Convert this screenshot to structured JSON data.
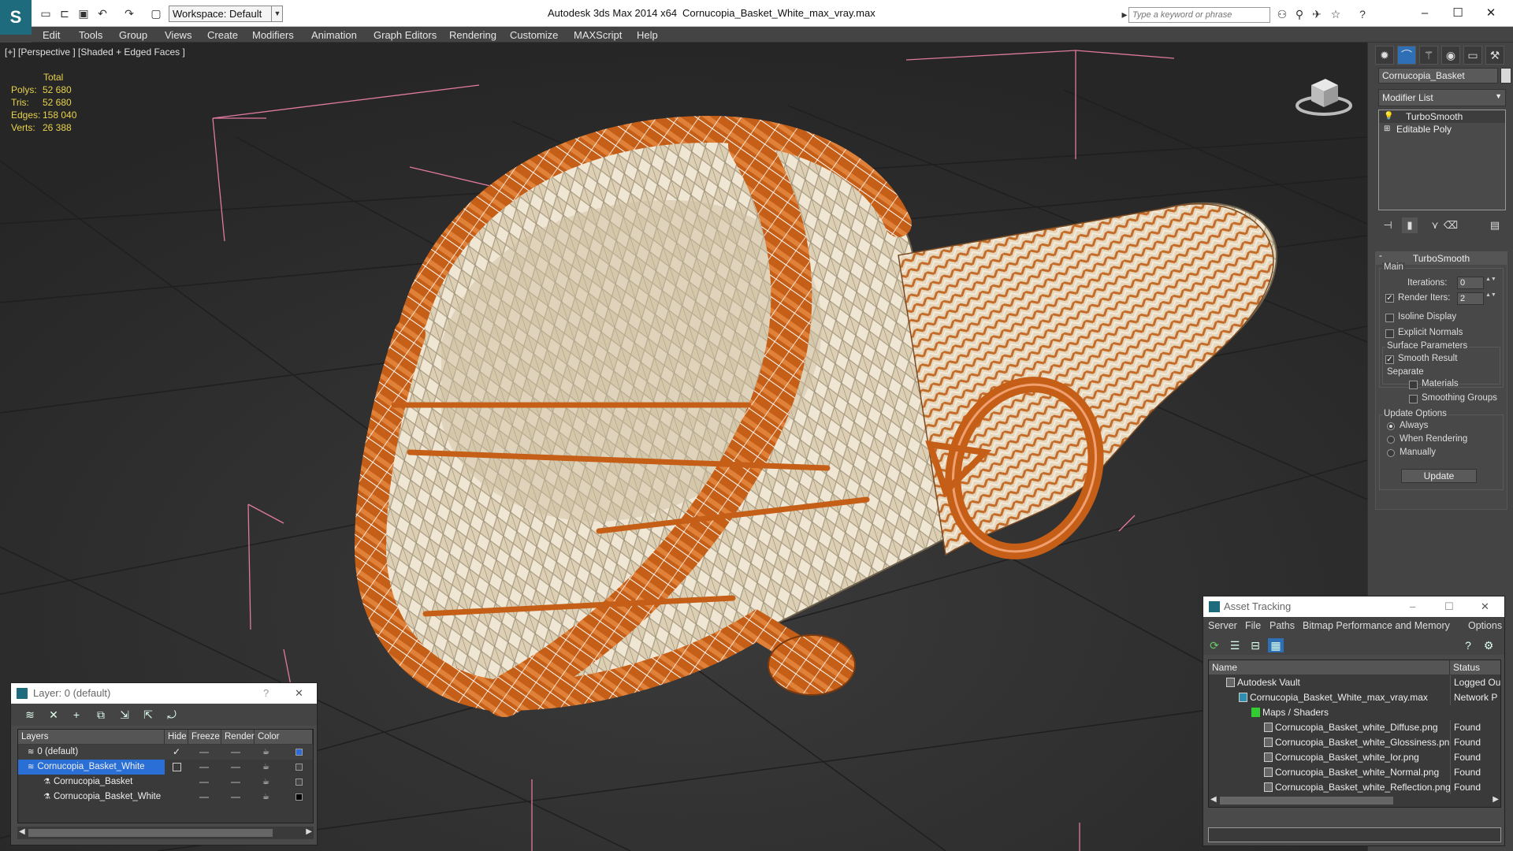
{
  "app": {
    "name": "Autodesk 3ds Max  2014 x64",
    "file": "Cornucopia_Basket_White_max_vray.max",
    "workspace": "Workspace: Default",
    "search_placeholder": "Type a keyword or phrase"
  },
  "menu": [
    "Edit",
    "Tools",
    "Group",
    "Views",
    "Create",
    "Modifiers",
    "Animation",
    "Graph Editors",
    "Rendering",
    "Customize",
    "MAXScript",
    "Help"
  ],
  "viewport": {
    "label": "[+] [Perspective ] [Shaded + Edged Faces ]",
    "stats": {
      "header": "Total",
      "rows": [
        {
          "key": "Polys:",
          "value": "52 680"
        },
        {
          "key": "Tris:",
          "value": "52 680"
        },
        {
          "key": "Edges:",
          "value": "158 040"
        },
        {
          "key": "Verts:",
          "value": "26 388"
        }
      ]
    }
  },
  "command_panel": {
    "object_name": "Cornucopia_Basket",
    "modifier_list": "Modifier List",
    "stack": [
      "TurboSmooth",
      "Editable Poly"
    ],
    "rollout": {
      "title": "TurboSmooth",
      "main": "Main",
      "iterations_label": "Iterations:",
      "iterations_value": "0",
      "render_iters_label": "Render Iters:",
      "render_iters_value": "2",
      "isoline": "Isoline Display",
      "explicit": "Explicit Normals",
      "surface_params": "Surface Parameters",
      "smooth_result": "Smooth Result",
      "separate": "Separate",
      "materials": "Materials",
      "smoothing_groups": "Smoothing Groups",
      "update_options": "Update Options",
      "always": "Always",
      "when_rendering": "When Rendering",
      "manually": "Manually",
      "update_button": "Update"
    }
  },
  "layer_window": {
    "title": "Layer: 0 (default)",
    "help": "?",
    "close": "✕",
    "columns": [
      "Layers",
      "Hide",
      "Freeze",
      "Render",
      "Color"
    ],
    "rows": [
      {
        "name": "0 (default)",
        "color": "#2f6bd8"
      },
      {
        "name": "Cornucopia_Basket_White",
        "color": "#444444"
      },
      {
        "name": "Cornucopia_Basket",
        "color": "#444444"
      },
      {
        "name": "Cornucopia_Basket_White",
        "color": "#000000"
      }
    ]
  },
  "asset_window": {
    "title": "Asset Tracking",
    "menu": [
      "Server",
      "File",
      "Paths",
      "Bitmap Performance and Memory",
      "Options"
    ],
    "columns": [
      "Name",
      "Status"
    ],
    "rows": [
      {
        "name": "Autodesk Vault",
        "status": "Logged Ou"
      },
      {
        "name": "Cornucopia_Basket_White_max_vray.max",
        "status": "Network P"
      },
      {
        "name": "Maps / Shaders",
        "status": ""
      },
      {
        "name": "Cornucopia_Basket_white_Diffuse.png",
        "status": "Found"
      },
      {
        "name": "Cornucopia_Basket_white_Glossiness.png",
        "status": "Found"
      },
      {
        "name": "Cornucopia_Basket_white_Ior.png",
        "status": "Found"
      },
      {
        "name": "Cornucopia_Basket_white_Normal.png",
        "status": "Found"
      },
      {
        "name": "Cornucopia_Basket_white_Reflection.png",
        "status": "Found"
      }
    ]
  },
  "colors": {
    "wicker_orange": "#c9631a",
    "wicker_cream": "#e8dcc4",
    "bounding_box": "#e07aa0",
    "selection_blue": "#2a6fd6"
  }
}
